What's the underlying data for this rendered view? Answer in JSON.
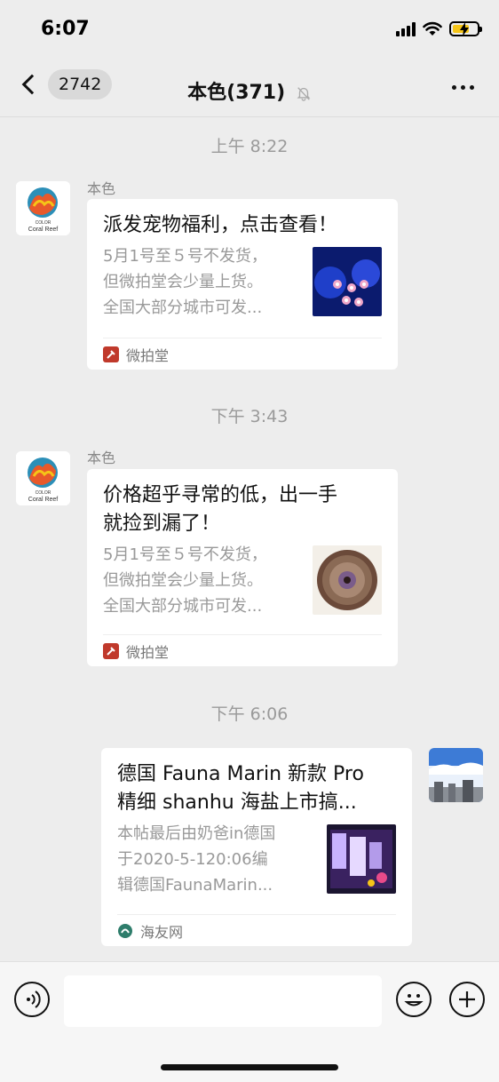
{
  "status_bar": {
    "time": "6:07"
  },
  "nav": {
    "unread_count": "2742",
    "title": "本色(371)"
  },
  "messages": [
    {
      "timestamp": "上午 8:22",
      "sender": "本色",
      "title": "派发宠物福利，点击查看！",
      "desc_lines": [
        "5月1号至５号不发货，",
        "但微拍堂会少量上货。",
        "全国大部分城市可发..."
      ],
      "source": "微拍堂"
    },
    {
      "timestamp": "下午 3:43",
      "sender": "本色",
      "title_lines": [
        "价格超乎寻常的低，出一手",
        "就捡到漏了！"
      ],
      "desc_lines": [
        "5月1号至５号不发货，",
        "但微拍堂会少量上货。",
        "全国大部分城市可发..."
      ],
      "source": "微拍堂"
    },
    {
      "timestamp": "下午 6:06",
      "title_lines": [
        "德国 Fauna Marin 新款 Pro",
        "精细 shanhu 海盐上市搞..."
      ],
      "desc_lines": [
        "本帖最后由奶爸in德国",
        "于2020-5-120:06编",
        "辑德国FaunaMarin..."
      ],
      "source": "海友网"
    }
  ],
  "avatar_logo": {
    "line1": "COLOR",
    "line2": "Coral Reef"
  },
  "colors": {
    "background": "#ededed",
    "card": "#ffffff",
    "muted_text": "#999999",
    "source_red": "#c0392b",
    "source_green": "#2e7d6b"
  }
}
